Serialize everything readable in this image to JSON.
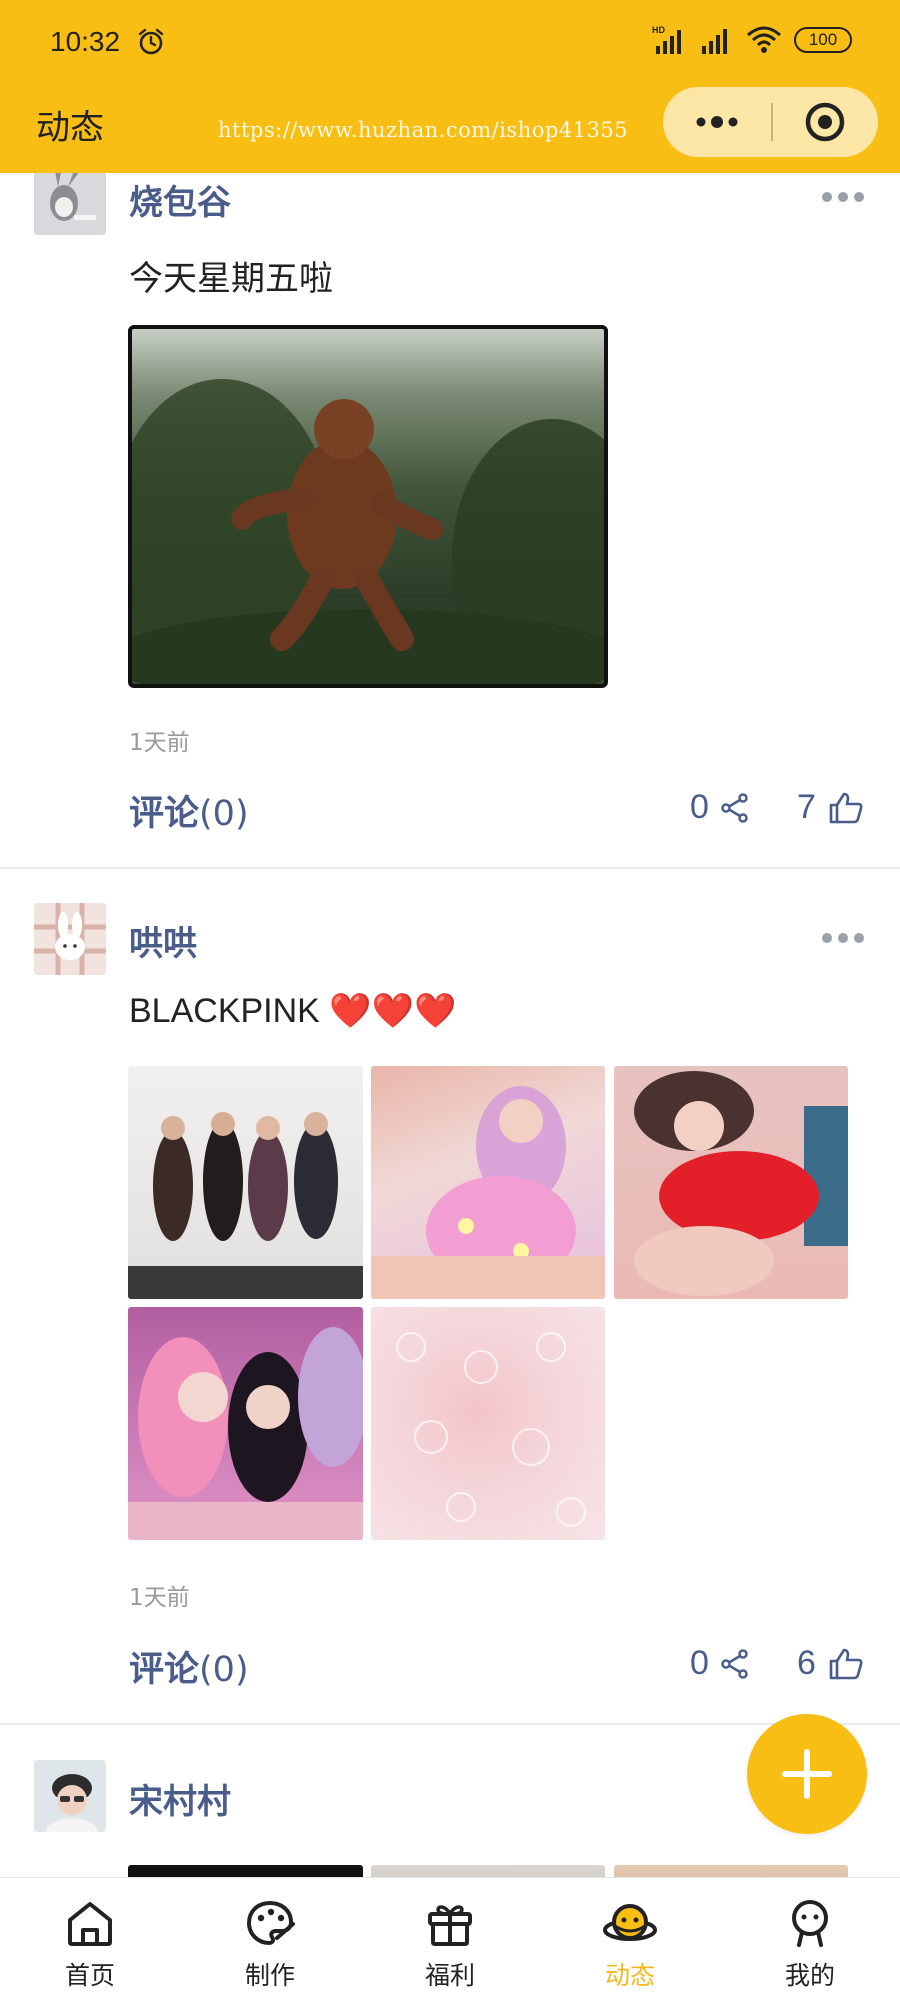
{
  "status_bar": {
    "time": "10:32",
    "battery": "100"
  },
  "header": {
    "title": "动态",
    "watermark": "https://www.huzhan.com/ishop41355"
  },
  "posts": [
    {
      "username": "烧包谷",
      "text": "今天星期五啦",
      "image_count": 1,
      "timestamp": "1天前",
      "comment_label": "评论",
      "comment_count": "(0)",
      "share_count": "0",
      "like_count": "7"
    },
    {
      "username": "哄哄",
      "text": "BLACKPINK ❤️❤️❤️",
      "image_count": 5,
      "timestamp": "1天前",
      "comment_label": "评论",
      "comment_count": "(0)",
      "share_count": "0",
      "like_count": "6"
    },
    {
      "username": "宋村村"
    }
  ],
  "tabbar": {
    "items": [
      {
        "label": "首页",
        "icon": "home-icon"
      },
      {
        "label": "制作",
        "icon": "palette-icon"
      },
      {
        "label": "福利",
        "icon": "gift-icon"
      },
      {
        "label": "动态",
        "icon": "planet-icon",
        "active": true
      },
      {
        "label": "我的",
        "icon": "user-icon"
      }
    ]
  },
  "colors": {
    "accent": "#F8BE14",
    "username": "#4A5D8A",
    "active_tab": "#F5B71A"
  }
}
